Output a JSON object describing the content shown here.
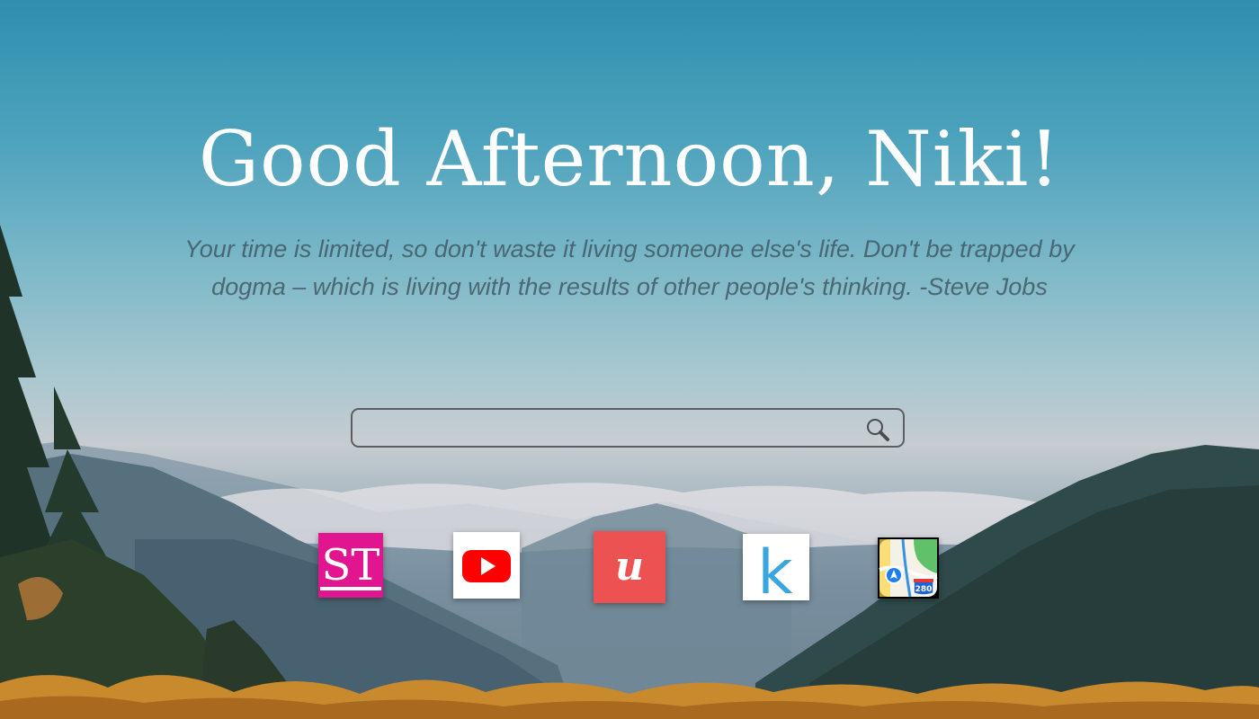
{
  "greeting": "Good Afternoon, Niki!",
  "quote": "Your time is limited, so don't waste it living someone else's life. Don't be trapped by dogma – which is living with the results of other people's thinking. -Steve Jobs",
  "search": {
    "value": "",
    "placeholder": "",
    "icon": "magnifier-icon"
  },
  "shortcuts": [
    {
      "name": "st-shortcut",
      "icon": "st-logo-icon",
      "text": "ST",
      "color": "#e0158f"
    },
    {
      "name": "youtube-shortcut",
      "icon": "youtube-play-icon",
      "color": "#ff0000"
    },
    {
      "name": "udemy-shortcut",
      "icon": "udemy-u-icon",
      "text": "u",
      "color": "#ec5252"
    },
    {
      "name": "kindle-shortcut",
      "icon": "k-letter-icon",
      "text": "k",
      "color": "#3aa6de"
    },
    {
      "name": "maps-shortcut",
      "icon": "apple-maps-icon",
      "text": "280",
      "color": "#61c16b"
    }
  ]
}
